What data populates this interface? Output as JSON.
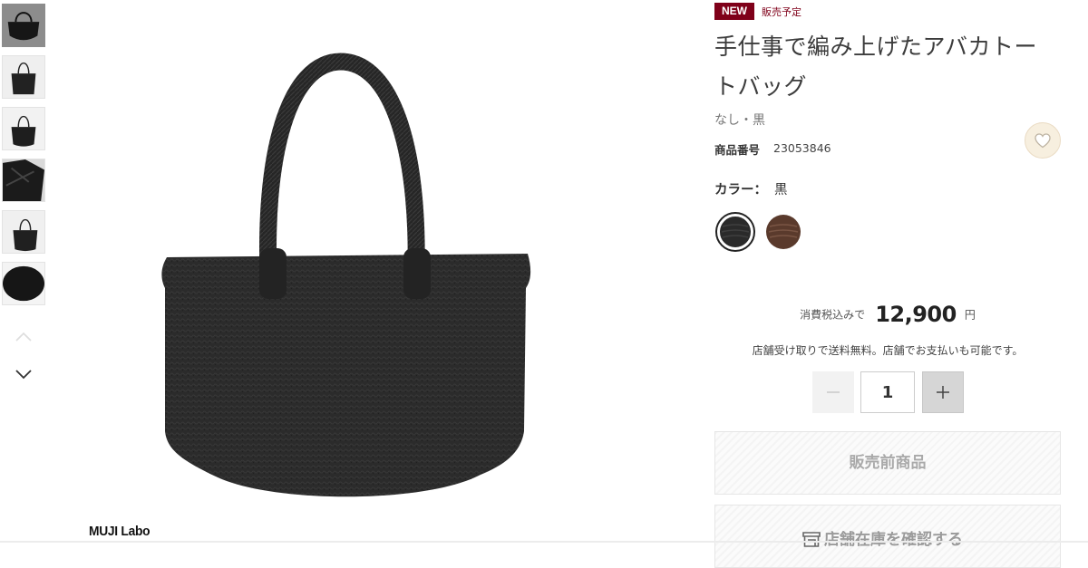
{
  "gallery": {
    "thumbnails": [
      {
        "icon": "tote-bag-front-thumbnail",
        "selected": true
      },
      {
        "icon": "tote-bag-model-thumbnail",
        "selected": false
      },
      {
        "icon": "tote-bag-model-thumbnail",
        "selected": false
      },
      {
        "icon": "tote-bag-detail-thumbnail",
        "selected": false
      },
      {
        "icon": "tote-bag-model-thumbnail",
        "selected": false
      },
      {
        "icon": "tote-bag-top-thumbnail",
        "selected": false
      }
    ],
    "prev_icon": "chevron-up-icon",
    "next_icon": "chevron-down-icon",
    "main_image": "black-abaca-tote-bag"
  },
  "brand": {
    "logo_text": "MUJI Labo"
  },
  "product": {
    "badge_new": "NEW",
    "badge_status": "販売予定",
    "title": "手仕事で編み上げたアバカトートバッグ",
    "subtitle": "なし・黒",
    "product_no_label": "商品番号",
    "product_no": "23053846",
    "color_label": "カラー：",
    "color_value": "黒",
    "colors": [
      {
        "name": "black",
        "hex": "#2a2a2a",
        "selected": true
      },
      {
        "name": "brown",
        "hex": "#5a3a2c",
        "selected": false
      }
    ]
  },
  "price": {
    "prefix": "消費税込みで",
    "value": "12,900",
    "unit": "円",
    "shipping_note": "店舗受け取りで送料無料。店舗でお支払いも可能です。"
  },
  "quantity": {
    "value": "1"
  },
  "buttons": {
    "presale": "販売前商品",
    "store_stock": "店舗在庫を確認する"
  },
  "colors": {
    "accent": "#7f0019",
    "favorite_bg": "#f7efdf"
  }
}
